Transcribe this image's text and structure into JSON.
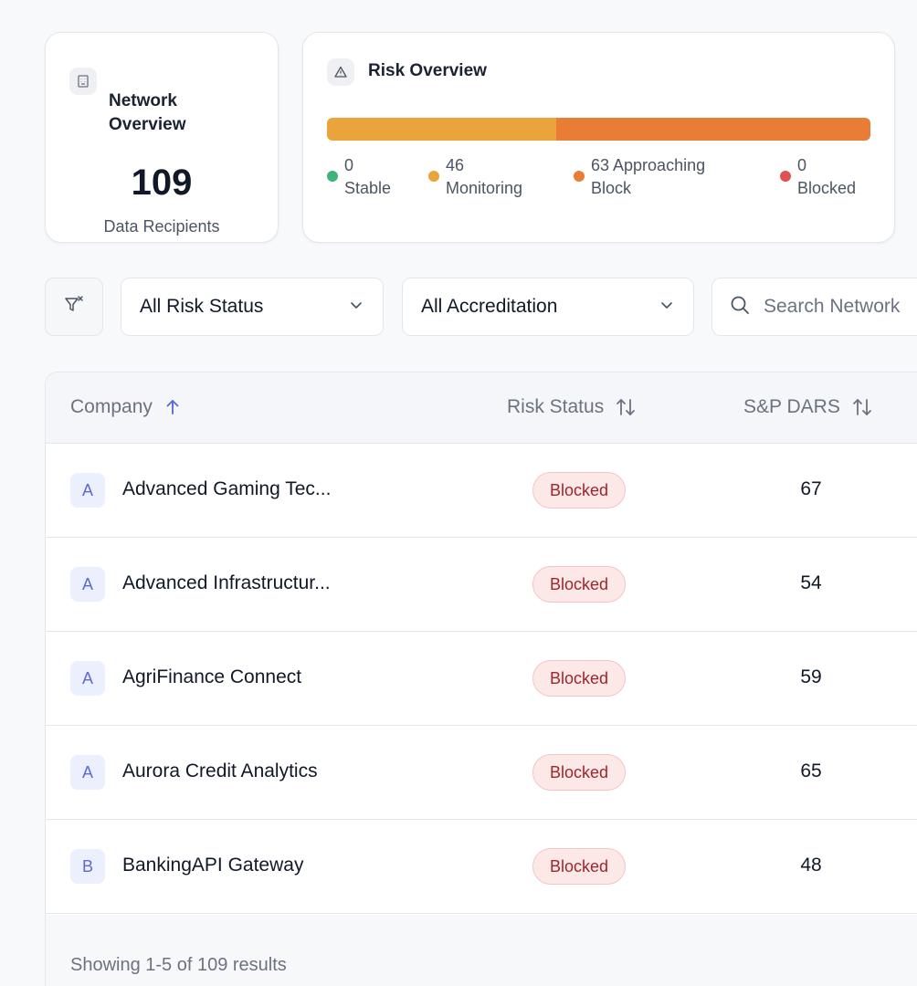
{
  "network_overview": {
    "title": "Network Overview",
    "count": "109",
    "subtitle": "Data Recipients",
    "icon": "building-icon"
  },
  "risk_overview": {
    "title": "Risk Overview",
    "icon": "warning-triangle-icon",
    "segments": [
      {
        "label": "Stable",
        "count": 0,
        "color": "#3fb37a"
      },
      {
        "label": "Monitoring",
        "count": 46,
        "color": "#eba43c"
      },
      {
        "label": "Approaching Block",
        "count": 63,
        "color": "#ea7d36"
      },
      {
        "label": "Blocked",
        "count": 0,
        "color": "#e05252"
      }
    ],
    "legend": [
      {
        "count": "0",
        "label": "Stable"
      },
      {
        "count": "46",
        "label": "Monitoring"
      },
      {
        "count": "63 Approaching",
        "label": "Block"
      },
      {
        "count": "0",
        "label": "Blocked"
      }
    ]
  },
  "filters": {
    "clear_icon": "filter-clear-icon",
    "risk_status": "All Risk Status",
    "accreditation": "All Accreditation",
    "search_placeholder": "Search Network"
  },
  "table": {
    "columns": {
      "company": "Company",
      "risk_status": "Risk Status",
      "dars": "S&P DARS"
    },
    "rows": [
      {
        "initial": "A",
        "company": "Advanced Gaming Tec...",
        "status": "Blocked",
        "dars": "67"
      },
      {
        "initial": "A",
        "company": "Advanced Infrastructur...",
        "status": "Blocked",
        "dars": "54"
      },
      {
        "initial": "A",
        "company": "AgriFinance Connect",
        "status": "Blocked",
        "dars": "59"
      },
      {
        "initial": "A",
        "company": "Aurora Credit Analytics",
        "status": "Blocked",
        "dars": "65"
      },
      {
        "initial": "B",
        "company": "BankingAPI Gateway",
        "status": "Blocked",
        "dars": "48"
      }
    ],
    "footer": "Showing 1-5 of 109 results"
  },
  "colors": {
    "accent": "#5b6bd5",
    "blocked_bg": "#fde8e8",
    "blocked_text": "#a0252b"
  }
}
